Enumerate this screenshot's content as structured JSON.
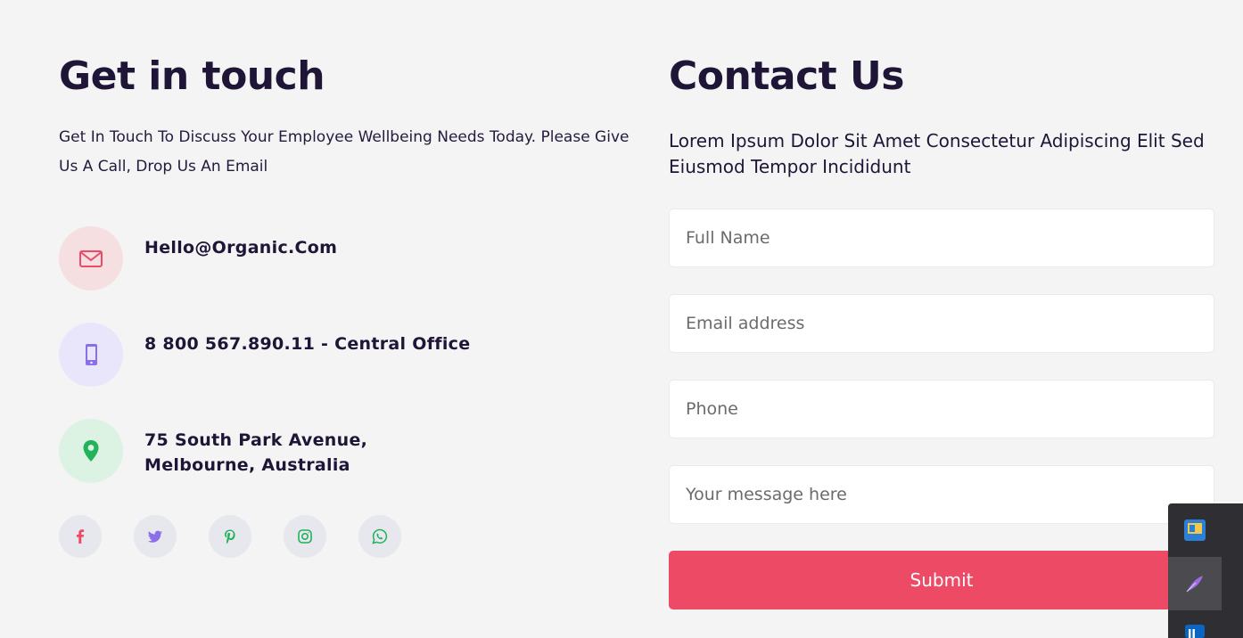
{
  "left": {
    "title": "Get in touch",
    "intro": "Get In Touch To Discuss Your Employee Wellbeing Needs Today. Please Give Us A Call, Drop Us An Email",
    "contacts": [
      {
        "icon": "envelope-icon",
        "text": "Hello@Organic.Com",
        "color": "#ec4a65"
      },
      {
        "icon": "mobile-phone-icon",
        "text": "8 800 567.890.11 - Central Office",
        "color": "#8a6fe8"
      },
      {
        "icon": "location-pin-icon",
        "text": "75 South Park Avenue, Melbourne, Australia",
        "color": "#22b25a"
      }
    ],
    "socials": [
      {
        "icon": "facebook-icon",
        "color": "#ec4a65"
      },
      {
        "icon": "twitter-icon",
        "color": "#8a6fe8"
      },
      {
        "icon": "pinterest-icon",
        "color": "#22b25a"
      },
      {
        "icon": "instagram-icon",
        "color": "#22b25a"
      },
      {
        "icon": "whatsapp-icon",
        "color": "#22b25a"
      }
    ]
  },
  "right": {
    "title": "Contact Us",
    "lead": "Lorem Ipsum Dolor Sit Amet Consectetur Adipiscing Elit Sed Eiusmod Tempor Incididunt",
    "form": {
      "full_name_placeholder": "Full Name",
      "email_placeholder": "Email address",
      "phone_placeholder": "Phone",
      "message_placeholder": "Your message here",
      "submit_label": "Submit"
    }
  },
  "tray": {
    "items": [
      "app-launcher-icon",
      "feather-pen-icon",
      "linkedin-icon"
    ]
  },
  "colors": {
    "accent": "#ec4a65",
    "heading": "#1f1537",
    "background": "#f4f4f4"
  }
}
